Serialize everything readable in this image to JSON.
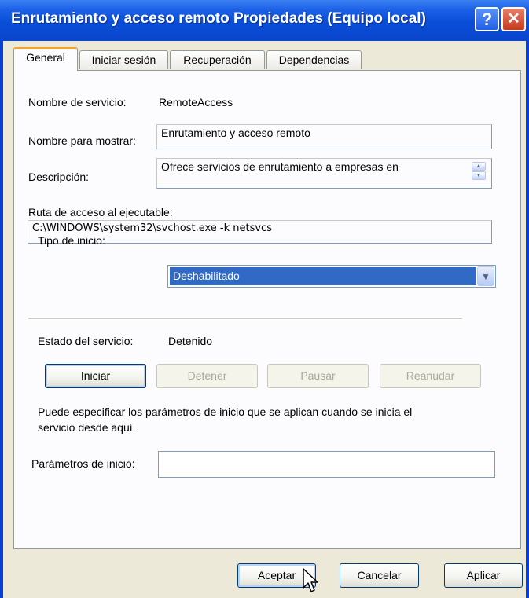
{
  "window": {
    "title": "Enrutamiento y acceso remoto Propiedades (Equipo local)",
    "help_glyph": "?",
    "close_glyph": "✕"
  },
  "tabs": [
    {
      "label": "General",
      "active": true
    },
    {
      "label": "Iniciar sesión",
      "active": false
    },
    {
      "label": "Recuperación",
      "active": false
    },
    {
      "label": "Dependencias",
      "active": false
    }
  ],
  "general": {
    "service_name_label": "Nombre de servicio:",
    "service_name_value": "RemoteAccess",
    "display_name_label": "Nombre para mostrar:",
    "display_name_value": "Enrutamiento y acceso remoto",
    "description_label": "Descripción:",
    "description_value": "Ofrece servicios de enrutamiento a empresas en",
    "exe_path_label": "Ruta de acceso al ejecutable:",
    "exe_path_value": "C:\\WINDOWS\\system32\\svchost.exe -k netsvcs",
    "startup_type_label": "Tipo de inicio:",
    "startup_type_value": "Deshabilitado",
    "status_label": "Estado del servicio:",
    "status_value": "Detenido",
    "buttons": {
      "start": "Iniciar",
      "stop": "Detener",
      "pause": "Pausar",
      "resume": "Reanudar"
    },
    "hint_line1": "Puede especificar los parámetros de inicio que se aplican cuando se inicia el",
    "hint_line2": "servicio desde aquí.",
    "start_params_label": "Parámetros de inicio:",
    "start_params_value": ""
  },
  "footer": {
    "ok": "Aceptar",
    "cancel": "Cancelar",
    "apply": "Aplicar"
  },
  "colors": {
    "title_bar": "#0a4ed8",
    "selection": "#316ac5",
    "dialog_face": "#ece9d8",
    "tab_highlight": "#f7a32b"
  }
}
